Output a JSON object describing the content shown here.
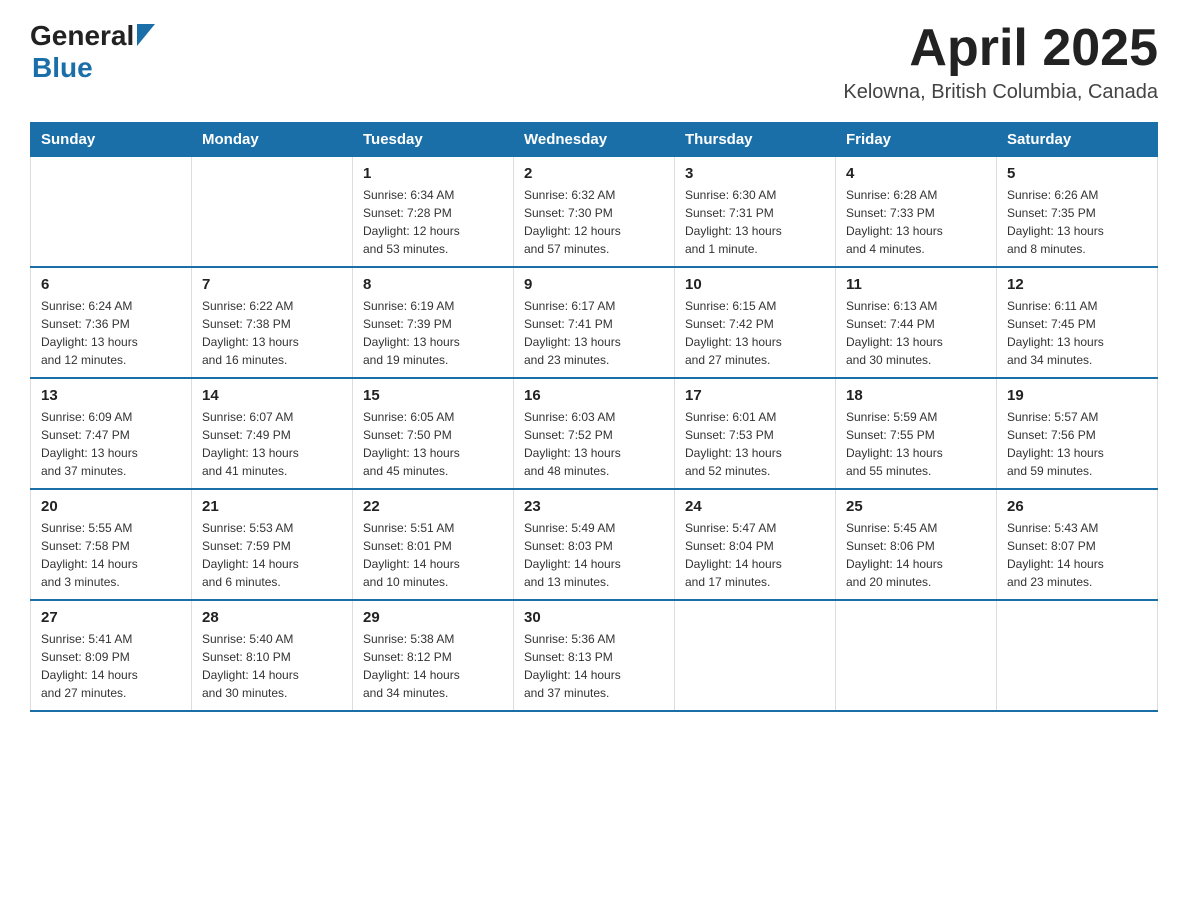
{
  "logo": {
    "general": "General",
    "blue": "Blue"
  },
  "title": {
    "month_year": "April 2025",
    "location": "Kelowna, British Columbia, Canada"
  },
  "weekdays": [
    "Sunday",
    "Monday",
    "Tuesday",
    "Wednesday",
    "Thursday",
    "Friday",
    "Saturday"
  ],
  "weeks": [
    [
      {
        "day": "",
        "info": ""
      },
      {
        "day": "",
        "info": ""
      },
      {
        "day": "1",
        "info": "Sunrise: 6:34 AM\nSunset: 7:28 PM\nDaylight: 12 hours\nand 53 minutes."
      },
      {
        "day": "2",
        "info": "Sunrise: 6:32 AM\nSunset: 7:30 PM\nDaylight: 12 hours\nand 57 minutes."
      },
      {
        "day": "3",
        "info": "Sunrise: 6:30 AM\nSunset: 7:31 PM\nDaylight: 13 hours\nand 1 minute."
      },
      {
        "day": "4",
        "info": "Sunrise: 6:28 AM\nSunset: 7:33 PM\nDaylight: 13 hours\nand 4 minutes."
      },
      {
        "day": "5",
        "info": "Sunrise: 6:26 AM\nSunset: 7:35 PM\nDaylight: 13 hours\nand 8 minutes."
      }
    ],
    [
      {
        "day": "6",
        "info": "Sunrise: 6:24 AM\nSunset: 7:36 PM\nDaylight: 13 hours\nand 12 minutes."
      },
      {
        "day": "7",
        "info": "Sunrise: 6:22 AM\nSunset: 7:38 PM\nDaylight: 13 hours\nand 16 minutes."
      },
      {
        "day": "8",
        "info": "Sunrise: 6:19 AM\nSunset: 7:39 PM\nDaylight: 13 hours\nand 19 minutes."
      },
      {
        "day": "9",
        "info": "Sunrise: 6:17 AM\nSunset: 7:41 PM\nDaylight: 13 hours\nand 23 minutes."
      },
      {
        "day": "10",
        "info": "Sunrise: 6:15 AM\nSunset: 7:42 PM\nDaylight: 13 hours\nand 27 minutes."
      },
      {
        "day": "11",
        "info": "Sunrise: 6:13 AM\nSunset: 7:44 PM\nDaylight: 13 hours\nand 30 minutes."
      },
      {
        "day": "12",
        "info": "Sunrise: 6:11 AM\nSunset: 7:45 PM\nDaylight: 13 hours\nand 34 minutes."
      }
    ],
    [
      {
        "day": "13",
        "info": "Sunrise: 6:09 AM\nSunset: 7:47 PM\nDaylight: 13 hours\nand 37 minutes."
      },
      {
        "day": "14",
        "info": "Sunrise: 6:07 AM\nSunset: 7:49 PM\nDaylight: 13 hours\nand 41 minutes."
      },
      {
        "day": "15",
        "info": "Sunrise: 6:05 AM\nSunset: 7:50 PM\nDaylight: 13 hours\nand 45 minutes."
      },
      {
        "day": "16",
        "info": "Sunrise: 6:03 AM\nSunset: 7:52 PM\nDaylight: 13 hours\nand 48 minutes."
      },
      {
        "day": "17",
        "info": "Sunrise: 6:01 AM\nSunset: 7:53 PM\nDaylight: 13 hours\nand 52 minutes."
      },
      {
        "day": "18",
        "info": "Sunrise: 5:59 AM\nSunset: 7:55 PM\nDaylight: 13 hours\nand 55 minutes."
      },
      {
        "day": "19",
        "info": "Sunrise: 5:57 AM\nSunset: 7:56 PM\nDaylight: 13 hours\nand 59 minutes."
      }
    ],
    [
      {
        "day": "20",
        "info": "Sunrise: 5:55 AM\nSunset: 7:58 PM\nDaylight: 14 hours\nand 3 minutes."
      },
      {
        "day": "21",
        "info": "Sunrise: 5:53 AM\nSunset: 7:59 PM\nDaylight: 14 hours\nand 6 minutes."
      },
      {
        "day": "22",
        "info": "Sunrise: 5:51 AM\nSunset: 8:01 PM\nDaylight: 14 hours\nand 10 minutes."
      },
      {
        "day": "23",
        "info": "Sunrise: 5:49 AM\nSunset: 8:03 PM\nDaylight: 14 hours\nand 13 minutes."
      },
      {
        "day": "24",
        "info": "Sunrise: 5:47 AM\nSunset: 8:04 PM\nDaylight: 14 hours\nand 17 minutes."
      },
      {
        "day": "25",
        "info": "Sunrise: 5:45 AM\nSunset: 8:06 PM\nDaylight: 14 hours\nand 20 minutes."
      },
      {
        "day": "26",
        "info": "Sunrise: 5:43 AM\nSunset: 8:07 PM\nDaylight: 14 hours\nand 23 minutes."
      }
    ],
    [
      {
        "day": "27",
        "info": "Sunrise: 5:41 AM\nSunset: 8:09 PM\nDaylight: 14 hours\nand 27 minutes."
      },
      {
        "day": "28",
        "info": "Sunrise: 5:40 AM\nSunset: 8:10 PM\nDaylight: 14 hours\nand 30 minutes."
      },
      {
        "day": "29",
        "info": "Sunrise: 5:38 AM\nSunset: 8:12 PM\nDaylight: 14 hours\nand 34 minutes."
      },
      {
        "day": "30",
        "info": "Sunrise: 5:36 AM\nSunset: 8:13 PM\nDaylight: 14 hours\nand 37 minutes."
      },
      {
        "day": "",
        "info": ""
      },
      {
        "day": "",
        "info": ""
      },
      {
        "day": "",
        "info": ""
      }
    ]
  ]
}
